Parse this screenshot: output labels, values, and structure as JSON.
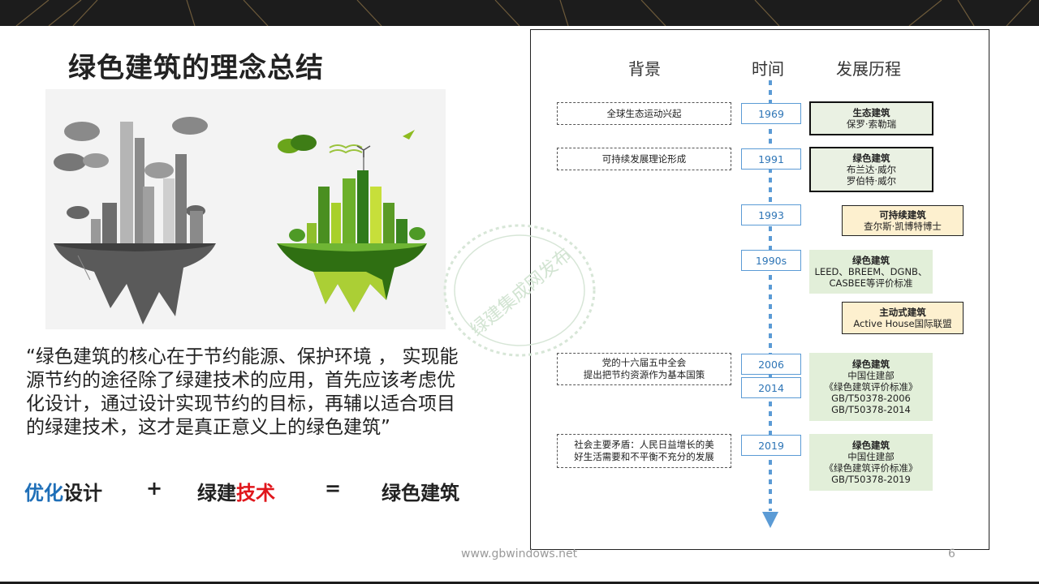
{
  "slide": {
    "title": "绿色建筑的理念总结",
    "quote": "“绿色建筑的核心在于节约能源、保护环境 ， 实现能源节约的途径除了绿建技术的应用，首先应该考虑优化设计，通过设计实现节约的目标，再辅以适合项目的绿建技术，这才是真正意义上的绿色建筑”",
    "equation": {
      "term1_blue": "优化",
      "term1_rest": "设计",
      "plus": "+",
      "term2_prefix": "绿建",
      "term2_red": "技术",
      "equals": "=",
      "result": "绿色建筑"
    },
    "footer_url": "www.gbwindows.net",
    "page_number": "6",
    "colors": {
      "blue": "#1f6fb8",
      "red": "#e0161b",
      "timeline": "#5b9bd5",
      "green_box": "#e2efd9",
      "tan_box": "#fdf0cf"
    }
  },
  "timeline": {
    "headers": {
      "background": "背景",
      "time": "时间",
      "development": "发展历程"
    },
    "watermark": "绿建集成网发布",
    "background_notes": [
      {
        "lines": [
          "全球生态运动兴起"
        ]
      },
      {
        "lines": [
          "可持续发展理论形成"
        ]
      },
      {
        "lines": [
          "党的十六届五中全会",
          "提出把节约资源作为基本国策"
        ]
      },
      {
        "lines": [
          "社会主要矛盾：人民日益增长的美",
          "好生活需要和不平衡不充分的发展"
        ]
      }
    ],
    "years": [
      "1969",
      "1991",
      "1993",
      "1990s",
      "2006",
      "2014",
      "2019"
    ],
    "developments": [
      {
        "title": "生态建筑",
        "lines": [
          "保罗·索勒瑞"
        ]
      },
      {
        "title": "绿色建筑",
        "lines": [
          "布兰达·威尔",
          "罗伯特·威尔"
        ]
      },
      {
        "title": "可持续建筑",
        "lines": [
          "查尔斯·凯博特博士"
        ]
      },
      {
        "title": "绿色建筑",
        "lines": [
          "LEED、BREEM、DGNB、",
          "CASBEE等评价标准"
        ]
      },
      {
        "title": "主动式建筑",
        "lines": [
          "Active House国际联盟"
        ]
      },
      {
        "title": "绿色建筑",
        "lines": [
          "中国住建部",
          "《绿色建筑评价标准》",
          "GB/T50378-2006",
          "GB/T50378-2014"
        ]
      },
      {
        "title": "绿色建筑",
        "lines": [
          "中国住建部",
          "《绿色建筑评价标准》",
          "GB/T50378-2019"
        ]
      }
    ]
  }
}
